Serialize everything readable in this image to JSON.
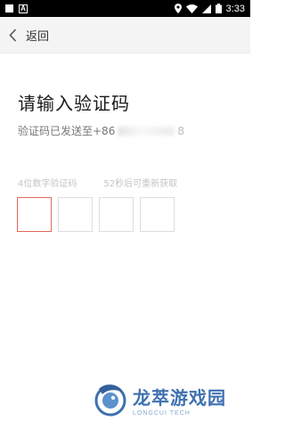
{
  "status_bar": {
    "time": "3:33",
    "left_icons": [
      "square-icon",
      "a-notification-icon"
    ],
    "right_icons": [
      "location-icon",
      "wifi-icon",
      "signal-icon",
      "battery-icon"
    ]
  },
  "app_bar": {
    "back_label": "返回"
  },
  "page": {
    "title": "请输入验证码",
    "sent_prefix": "验证码已发送至+86",
    "sent_suffix": "8"
  },
  "code_input": {
    "digits_label": "4位数字验证码",
    "resend_countdown": "52秒后可重新获取",
    "box_count": 4,
    "active_color": "#e0685a",
    "border_color": "#dedede"
  },
  "watermark": {
    "name": "龙萃游戏园",
    "subtitle": "LONGCUI TECH",
    "color": "#2a62a8"
  }
}
